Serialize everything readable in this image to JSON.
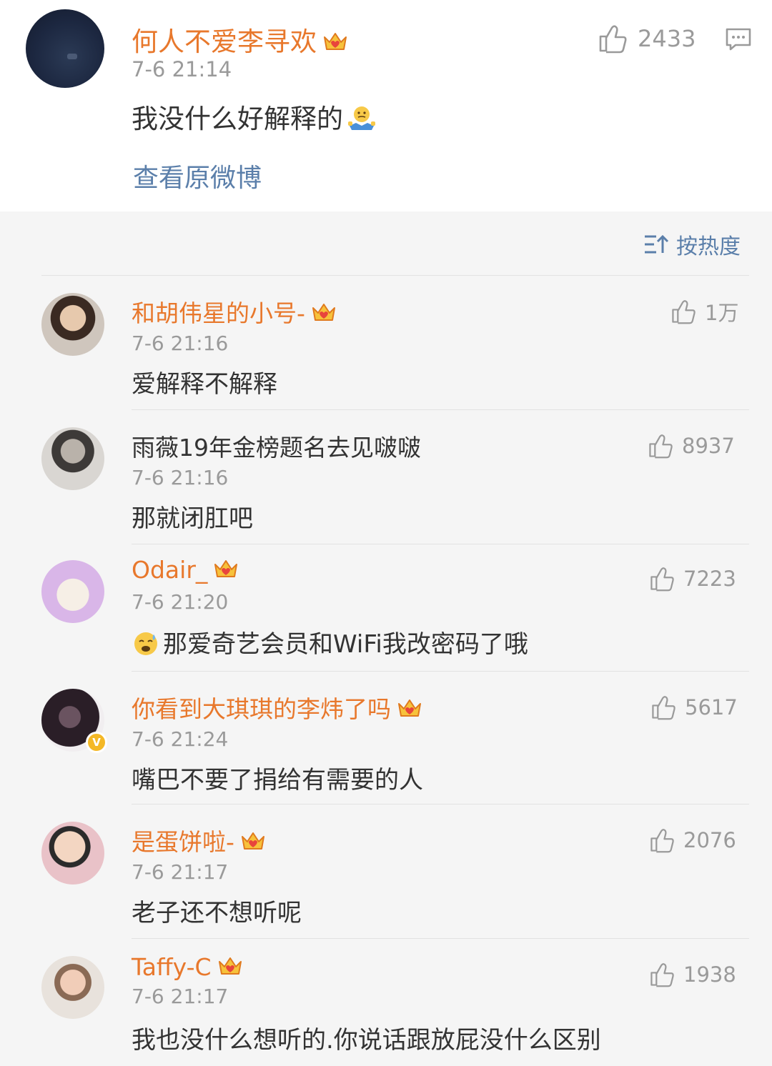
{
  "original_post_comment": {
    "username": "何人不爱李寻欢",
    "time": "7-6 21:14",
    "text": "我没什么好解释的",
    "emoji": "shrug-emoji",
    "likes": "2433",
    "view_original_label": "查看原微博"
  },
  "sort": {
    "label": "按热度"
  },
  "comments": [
    {
      "username": "和胡伟星的小号-",
      "vip": true,
      "time": "7-6 21:16",
      "text": "爱解释不解释",
      "likes": "1万"
    },
    {
      "username": "雨薇19年金榜题名去见啵啵",
      "vip": false,
      "time": "7-6 21:16",
      "text": "那就闭肛吧",
      "likes": "8937"
    },
    {
      "username": "Odair_",
      "vip": true,
      "time": "7-6 21:20",
      "text": "那爱奇艺会员和WiFi我改密码了哦",
      "emoji": "cold-sweat-emoji",
      "likes": "7223"
    },
    {
      "username": "你看到大琪琪的李炜了吗",
      "vip": true,
      "verified": true,
      "time": "7-6 21:24",
      "text": "嘴巴不要了捐给有需要的人",
      "likes": "5617"
    },
    {
      "username": "是蛋饼啦-",
      "vip": true,
      "time": "7-6 21:17",
      "text": "老子还不想听呢",
      "likes": "2076"
    },
    {
      "username": "Taffy-C",
      "vip": true,
      "time": "7-6 21:17",
      "text": "我也没什么想听的.你说话跟放屁没什么区别",
      "likes": "1938"
    }
  ],
  "colors": {
    "vip_name": "#e8782c",
    "link_blue": "#5b7faa",
    "muted": "#9a9a9a",
    "text": "#333333",
    "background": "#f5f5f5"
  }
}
